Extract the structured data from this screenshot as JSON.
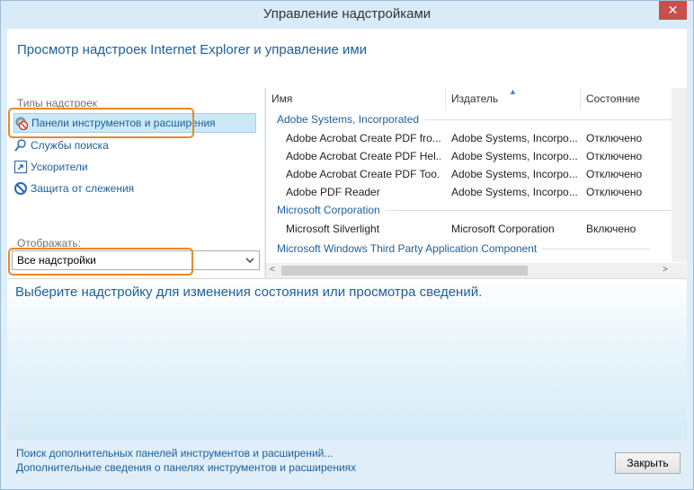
{
  "window": {
    "title": "Управление надстройками",
    "close_glyph": "✕"
  },
  "header": {
    "text": "Просмотр надстроек Internet Explorer и управление ими"
  },
  "left": {
    "types_label": "Типы надстроек",
    "types": [
      {
        "label": "Панели инструментов и расширения",
        "icon": "gear-blocked-icon"
      },
      {
        "label": "Службы поиска",
        "icon": "search-icon"
      },
      {
        "label": "Ускорители",
        "icon": "accelerator-icon"
      },
      {
        "label": "Защита от слежения",
        "icon": "no-tracking-icon"
      }
    ],
    "show_label": "Отображать:",
    "show_value": "Все надстройки"
  },
  "list": {
    "columns": [
      "Имя",
      "Издатель",
      "Состояние"
    ],
    "groups": [
      {
        "name": "Adobe Systems, Incorporated"
      },
      {
        "name": "Microsoft Corporation"
      },
      {
        "name": "Microsoft Windows Third Party Application Component"
      }
    ],
    "rows": [
      {
        "name": "Adobe Acrobat Create PDF fro...",
        "publisher": "Adobe Systems, Incorpo...",
        "status": "Отключено"
      },
      {
        "name": "Adobe Acrobat Create PDF Hel...",
        "publisher": "Adobe Systems, Incorpo...",
        "status": "Отключено"
      },
      {
        "name": "Adobe Acrobat Create PDF Too...",
        "publisher": "Adobe Systems, Incorpo...",
        "status": "Отключено"
      },
      {
        "name": "Adobe PDF Reader",
        "publisher": "Adobe Systems, Incorpo...",
        "status": "Отключено"
      },
      {
        "name": "Microsoft Silverlight",
        "publisher": "Microsoft Corporation",
        "status": "Включено"
      }
    ]
  },
  "detail": {
    "text": "Выберите надстройку для изменения состояния или просмотра сведений."
  },
  "footer": {
    "link1": "Поиск дополнительных панелей инструментов и расширений...",
    "link2": "Дополнительные сведения о панелях инструментов и расширениях",
    "close_label": "Закрыть"
  },
  "colors": {
    "accent": "#1e5f99",
    "highlight": "#e8882a",
    "close": "#c7504a"
  }
}
